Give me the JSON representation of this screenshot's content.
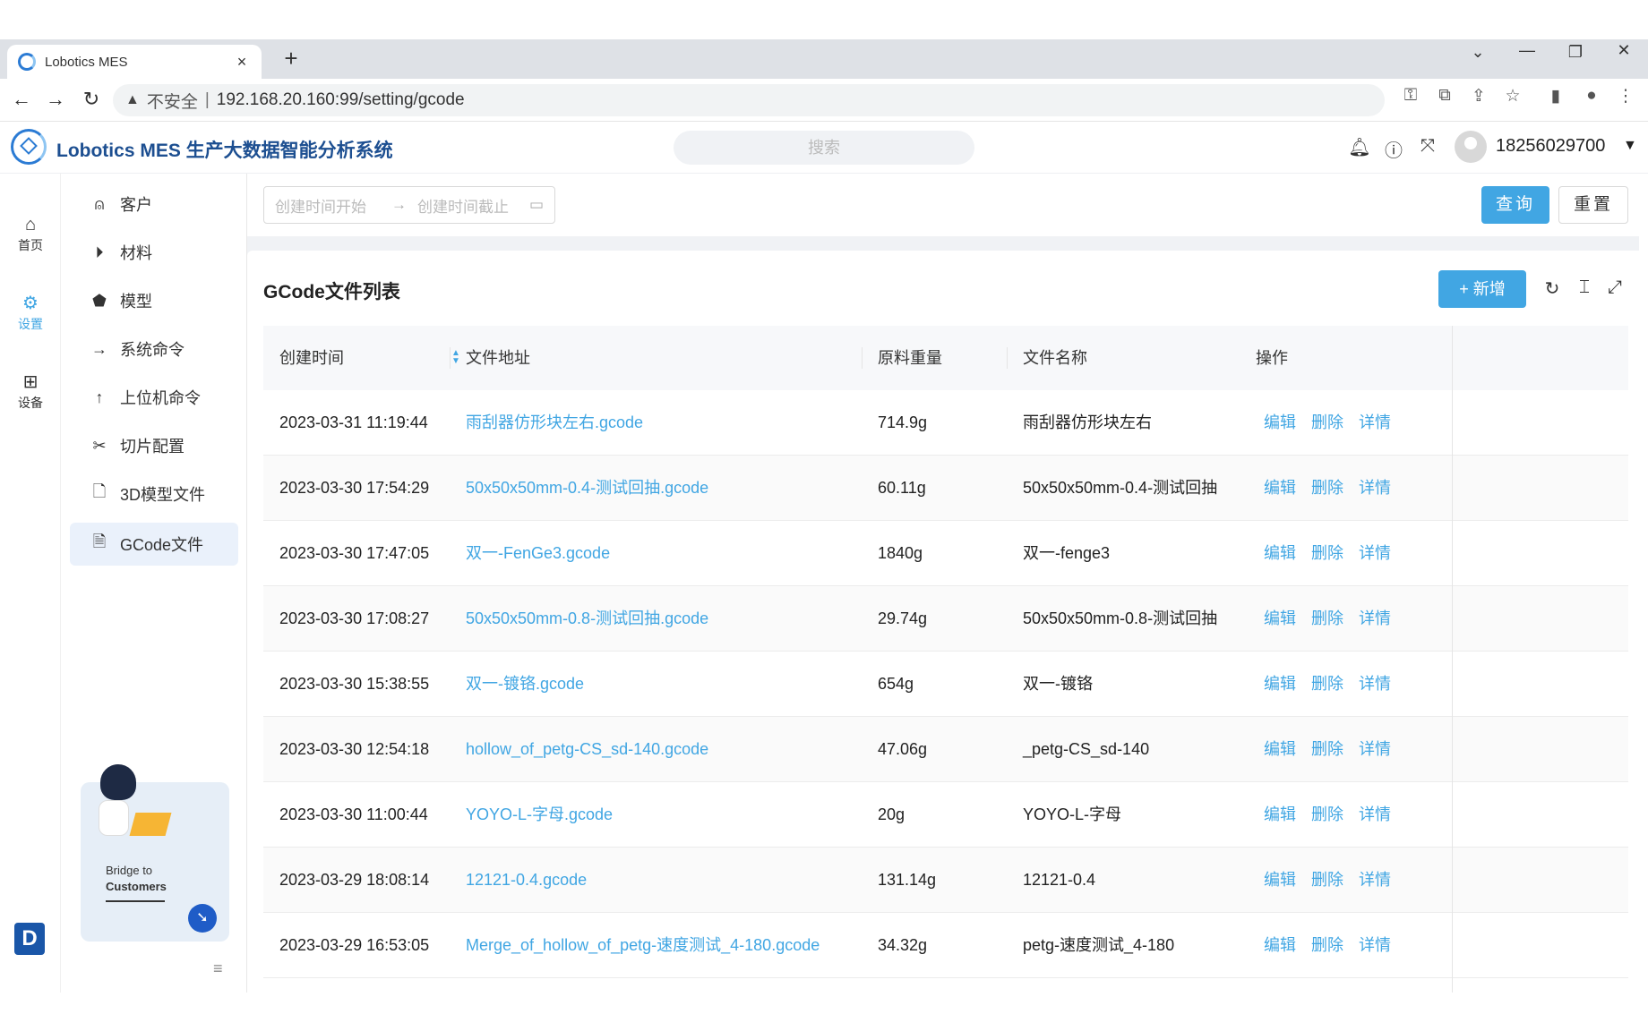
{
  "browser": {
    "tab_title": "Lobotics MES",
    "tab_close": "×",
    "new_tab": "+",
    "insecure_label": "不安全",
    "separator": "|",
    "url": "192.168.20.160:99/setting/gcode"
  },
  "header": {
    "title": "Lobotics MES 生产大数据智能分析系统",
    "search_placeholder": "搜索",
    "username": "18256029700"
  },
  "rail": [
    {
      "label": "首页",
      "icon": "home-icon",
      "glyph": "⌂"
    },
    {
      "label": "设置",
      "icon": "settings-icon",
      "glyph": "⚙"
    },
    {
      "label": "设备",
      "icon": "grid-icon",
      "glyph": "⊞"
    }
  ],
  "submenu": [
    {
      "label": "客户",
      "icon": "user-icon",
      "glyph": "⍝"
    },
    {
      "label": "材料",
      "icon": "material-icon",
      "glyph": "⏵"
    },
    {
      "label": "模型",
      "icon": "model-icon",
      "glyph": "⬟"
    },
    {
      "label": "系统命令",
      "icon": "arrow-right-icon",
      "glyph": "→"
    },
    {
      "label": "上位机命令",
      "icon": "arrow-up-icon",
      "glyph": "↑"
    },
    {
      "label": "切片配置",
      "icon": "scissors-icon",
      "glyph": "✂"
    },
    {
      "label": "3D模型文件",
      "icon": "file-icon",
      "glyph": "🗋"
    },
    {
      "label": "GCode文件",
      "icon": "gcode-file-icon",
      "glyph": "🗎"
    }
  ],
  "promo": {
    "line1": "Bridge to",
    "line2": "Customers"
  },
  "filter": {
    "start_placeholder": "创建时间开始",
    "end_placeholder": "创建时间截止",
    "query_label": "查询",
    "reset_label": "重置"
  },
  "card": {
    "title": "GCode文件列表",
    "add_label": "+ 新增"
  },
  "table": {
    "columns": [
      "创建时间",
      "文件地址",
      "原料重量",
      "文件名称",
      "操作"
    ],
    "actions": [
      "编辑",
      "删除",
      "详情"
    ],
    "rows": [
      {
        "time": "2023-03-31 11:19:44",
        "path": "雨刮器仿形块左右.gcode",
        "weight": "714.9g",
        "name": "雨刮器仿形块左右"
      },
      {
        "time": "2023-03-30 17:54:29",
        "path": "50x50x50mm-0.4-测试回抽.gcode",
        "weight": "60.11g",
        "name": "50x50x50mm-0.4-测试回抽"
      },
      {
        "time": "2023-03-30 17:47:05",
        "path": "双一-FenGe3.gcode",
        "weight": "1840g",
        "name": "双一-fenge3"
      },
      {
        "time": "2023-03-30 17:08:27",
        "path": "50x50x50mm-0.8-测试回抽.gcode",
        "weight": "29.74g",
        "name": "50x50x50mm-0.8-测试回抽"
      },
      {
        "time": "2023-03-30 15:38:55",
        "path": "双一-镀铬.gcode",
        "weight": "654g",
        "name": "双一-镀铬"
      },
      {
        "time": "2023-03-30 12:54:18",
        "path": "hollow_of_petg-CS_sd-140.gcode",
        "weight": "47.06g",
        "name": "_petg-CS_sd-140"
      },
      {
        "time": "2023-03-30 11:00:44",
        "path": "YOYO-L-字母.gcode",
        "weight": "20g",
        "name": "YOYO-L-字母"
      },
      {
        "time": "2023-03-29 18:08:14",
        "path": "12121-0.4.gcode",
        "weight": "131.14g",
        "name": "12121-0.4"
      },
      {
        "time": "2023-03-29 16:53:05",
        "path": "Merge_of_hollow_of_petg-速度测试_4-180.gcode",
        "weight": "34.32g",
        "name": "petg-速度测试_4-180"
      }
    ]
  },
  "colors": {
    "accent": "#41a6e3",
    "brand": "#1d4f91"
  }
}
